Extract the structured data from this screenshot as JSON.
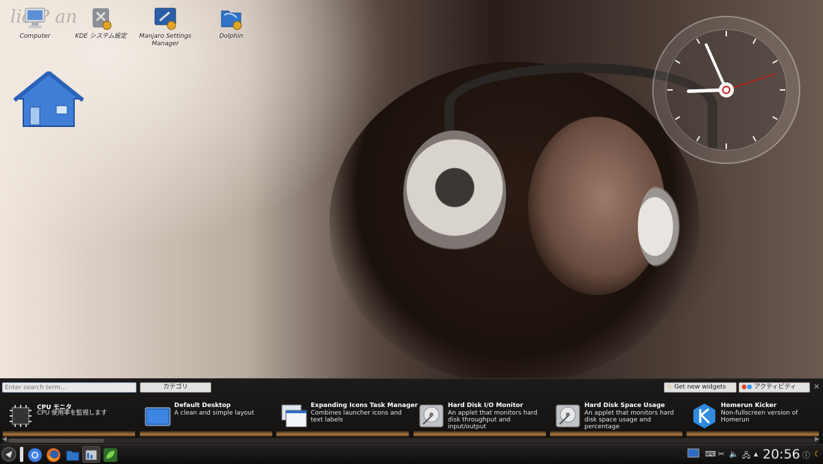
{
  "desktop": {
    "folder_view_watermark": "lic P  an",
    "icons": [
      {
        "label": "Computer",
        "icon": "computer-icon"
      },
      {
        "label": "KDE システム設定",
        "icon": "system-settings-icon"
      },
      {
        "label": "Manjaro Settings Manager",
        "icon": "manjaro-settings-icon"
      },
      {
        "label": "Dolphin",
        "icon": "dolphin-folder-icon"
      }
    ],
    "home_icon": "home-icon"
  },
  "clock_widget": {
    "hour": 8,
    "minute": 56,
    "second": 12
  },
  "widget_explorer": {
    "search_placeholder": "Enter search term...",
    "category_label": "カテゴリ",
    "get_widgets_label": "Get new widgets",
    "activities_label": "アクティビティ",
    "close_label": "✕",
    "widgets": [
      {
        "title": "CPU モニタ",
        "desc": "CPU 使用率を監視します",
        "icon": "cpu-chip-icon"
      },
      {
        "title": "Default Desktop",
        "desc": "A clean and simple layout",
        "icon": "desktop-screen-icon"
      },
      {
        "title": "Expanding Icons Task Manager",
        "desc": "Combines launcher icons and text labels",
        "icon": "windows-stack-icon"
      },
      {
        "title": "Hard Disk I/O Monitor",
        "desc": "An applet that monitors hard disk throughput and input/output",
        "icon": "hard-disk-icon"
      },
      {
        "title": "Hard Disk Space Usage",
        "desc": "An applet that monitors hard disk space usage and percentage",
        "icon": "hard-disk-icon"
      },
      {
        "title": "Homerun Kicker",
        "desc": "Non-fullscreen version of Homerun",
        "icon": "kde-k-icon"
      }
    ]
  },
  "taskbar": {
    "time": "20:56",
    "launchers": [
      "launcher-menu-icon",
      "chromium-icon",
      "firefox-icon",
      "dolphin-icon",
      "system-monitor-icon",
      "leaf-app-icon"
    ],
    "tray": [
      "screen-icon",
      "keyboard-icon",
      "cut-icon",
      "volume-icon",
      "network-icon",
      "expand-arrow-icon",
      "info-icon",
      "moon-icon"
    ]
  },
  "colors": {
    "accent_bar": "#c68a48",
    "panel_bg": "#121110",
    "clock_second_hand": "#d01818"
  }
}
